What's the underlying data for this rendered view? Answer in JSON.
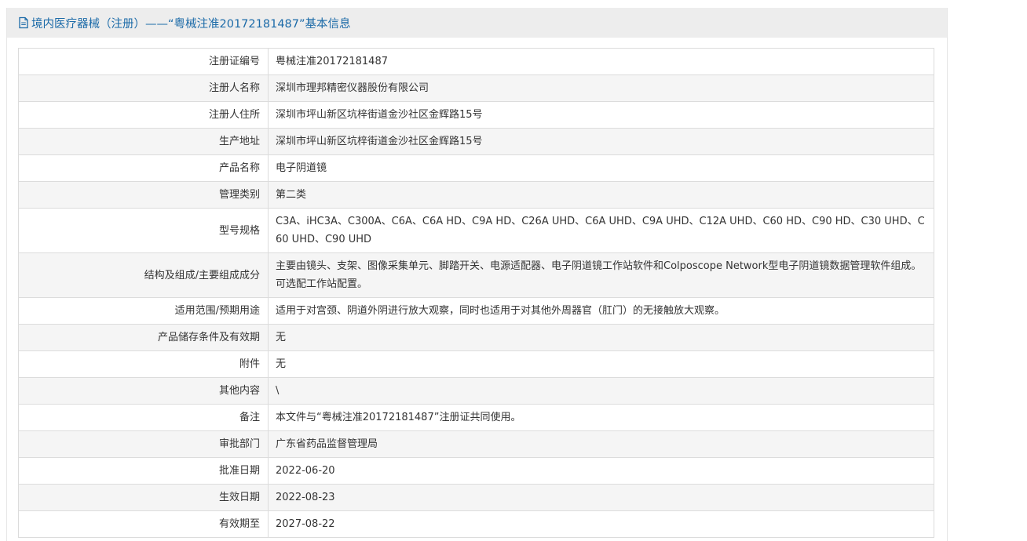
{
  "header": {
    "icon": "document-icon",
    "title": "境内医疗器械（注册）——“粤械注准20172181487”基本信息"
  },
  "rows": [
    {
      "label": "注册证编号",
      "value": "粤械注准20172181487"
    },
    {
      "label": "注册人名称",
      "value": "深圳市理邦精密仪器股份有限公司"
    },
    {
      "label": "注册人住所",
      "value": "深圳市坪山新区坑梓街道金沙社区金辉路15号"
    },
    {
      "label": "生产地址",
      "value": "深圳市坪山新区坑梓街道金沙社区金辉路15号"
    },
    {
      "label": "产品名称",
      "value": "电子阴道镜"
    },
    {
      "label": "管理类别",
      "value": "第二类"
    },
    {
      "label": "型号规格",
      "value": "C3A、iHC3A、C300A、C6A、C6A HD、C9A HD、C26A UHD、C6A UHD、C9A UHD、C12A UHD、C60 HD、C90 HD、C30 UHD、C60 UHD、C90 UHD"
    },
    {
      "label": "结构及组成/主要组成成分",
      "value": "主要由镜头、支架、图像采集单元、脚踏开关、电源适配器、电子阴道镜工作站软件和Colposcope Network型电子阴道镜数据管理软件组成。可选配工作站配置。"
    },
    {
      "label": "适用范围/预期用途",
      "value": "适用于对宫颈、阴道外阴进行放大观察，同时也适用于对其他外周器官（肛门）的无接触放大观察。"
    },
    {
      "label": "产品储存条件及有效期",
      "value": "无"
    },
    {
      "label": "附件",
      "value": "无"
    },
    {
      "label": "其他内容",
      "value": "\\"
    },
    {
      "label": "备注",
      "value": "本文件与“粤械注准20172181487”注册证共同使用。"
    },
    {
      "label": "审批部门",
      "value": "广东省药品监督管理局"
    },
    {
      "label": "批准日期",
      "value": "2022-06-20"
    },
    {
      "label": "生效日期",
      "value": "2022-08-23"
    },
    {
      "label": "有效期至",
      "value": "2027-08-22"
    }
  ]
}
